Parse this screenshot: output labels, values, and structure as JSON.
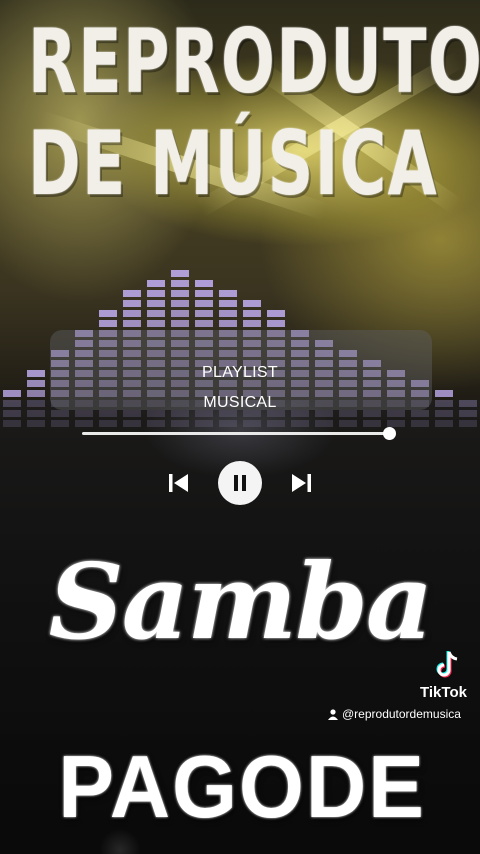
{
  "title": {
    "line1": "REPRODUTOR",
    "line2": "DE MÚSICA"
  },
  "player": {
    "label_line1": "PLAYLIST",
    "label_line2": "MUSICAL",
    "progress": 0.99,
    "controls": {
      "previous_icon": "skip-previous-icon",
      "pause_icon": "pause-icon",
      "next_icon": "skip-next-icon"
    }
  },
  "genres": {
    "primary": "Samba",
    "secondary": "PAGODE"
  },
  "watermark": {
    "brand": "TikTok",
    "handle": "@reprodutordemusica",
    "user_icon": "user-icon"
  },
  "colors": {
    "accent_eq": "#b9a6e6",
    "text": "#ffffff",
    "panel": "#5f5f64"
  }
}
